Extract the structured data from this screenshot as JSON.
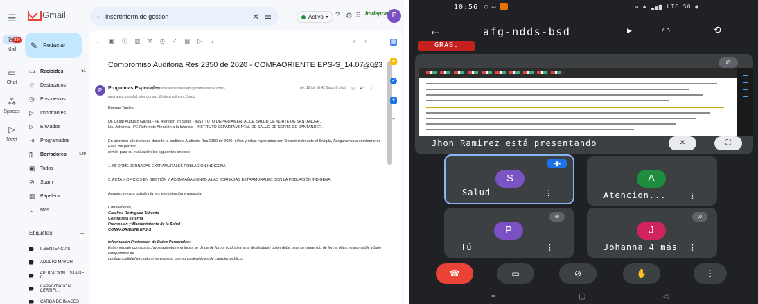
{
  "gmail": {
    "app_name": "Gmail",
    "search": {
      "query": "insertinform de gestion"
    },
    "status": "Activo",
    "org_logo": "Imdepran",
    "avatar_letter": "P",
    "rail": [
      {
        "label": "Mail",
        "badge": "•"
      },
      {
        "label": "Chat"
      },
      {
        "label": "Spaces"
      },
      {
        "label": "Meet"
      }
    ],
    "compose": "Redactar",
    "nav": [
      {
        "label": "Recibidos",
        "count": "51",
        "icon": "inbox-icon"
      },
      {
        "label": "Destacados",
        "icon": "star-icon"
      },
      {
        "label": "Pospuestos",
        "icon": "clock-icon"
      },
      {
        "label": "Importantes",
        "icon": "important-icon"
      },
      {
        "label": "Enviados",
        "icon": "send-icon"
      },
      {
        "label": "Programados",
        "icon": "scheduled-icon"
      },
      {
        "label": "Borradores",
        "count": "149",
        "icon": "draft-icon"
      },
      {
        "label": "Todos",
        "icon": "all-mail-icon"
      },
      {
        "label": "Spam",
        "icon": "spam-icon"
      },
      {
        "label": "Papelera",
        "icon": "trash-icon"
      },
      {
        "label": "Más",
        "icon": "chevron-down-icon"
      }
    ],
    "labels_title": "Etiquetas",
    "labels": [
      "9.SENTENCIAS",
      "ADULTO MAYOR",
      "APLICACION LISTA DE C...",
      "CAPACITACION CERTIFI...",
      "CARGA DE IMAGES"
    ],
    "mail": {
      "subject": "Compromiso Auditoria Res 2350 de 2020 - COMFAORIENTE EPS-S_14.07.2023",
      "sender_name": "Programas Especiales",
      "sender_email": "<programasespeciales.eps@comfaoriente.com>",
      "sender_to": "para atencionsalud, atencionsa...@iolsg.mail.com, Salud",
      "date": "mié, 19 jul, 18:42 (hace 9 días)",
      "body": [
        "Buenas Tardes",
        "Dr. Cesar Augusto Garcia - PE Atención en Salud - INSTITUTO DEPARTAMENTAL DE SALUD DE NORTE DE SANTANDER.\nLic. Johanna -  PE Referente Atención a la Infancia - INSTITUTO DEPARTAMENTAL DE SALUD DE NORTE DE SANTANDER.",
        "En atención a lo indicado durante la auditoria Auditoria Res 2350 de 2020, niños y niñas reportadas con Desnutrición ante el Sivigila, Aseguramos a comfaoriente Eoss me permito\nremitir para su evaluación los siguientes anexos:",
        "1.INFORME JORNADAS EXTRAMURALES POBLACION INDIGENA",
        "2. ACTA Y OFICIOS EN GESTIÓN Y ACOMPAÑAMIENTO A LAS JORNADAS EXTRAMURALES CON LA POBLACIÓN INDIGENA.",
        "Agradecemos a ustedes la vez eso atención y asesoria."
      ],
      "signature": [
        "Cordialmente,",
        "Carolina Rodriguez Taborda",
        "Contratista externa",
        "Promoción y Mantenimiento de la Salud",
        "COMFAORIENTE EPS-S"
      ],
      "footer_title": "Información Protección de Datos Personales:",
      "footer_text": "Este mensaje con sus archivos adjuntos y enlaces  se dirige de forma exclusiva a su destinatario quien debe usar su contenido de forma ética, responsable y bajo compromiso de\nconfidencialidad  excepto si es expreso que su contenido es de carácter publico."
    }
  },
  "meet": {
    "time": "10:56",
    "status_right": "LTE 50",
    "meeting_code": "afg-ndds-bsd",
    "recording_label": "GRAB.",
    "presenting_text": "Jhon Ramirez está presentando",
    "tiles": [
      {
        "letter": "S",
        "name": "Salud",
        "color": "#7b54c4",
        "speaking": true
      },
      {
        "letter": "A",
        "name": "Atencion...",
        "color": "#1e8e3e",
        "muted": false
      },
      {
        "letter": "P",
        "name": "Tú",
        "color": "#7b50c2",
        "muted": true
      },
      {
        "letter": "J",
        "name": "Johanna 4 más",
        "color": "#d1245f",
        "muted": true
      }
    ],
    "controls": [
      "end-call",
      "camera-off",
      "mic-off",
      "raise-hand",
      "more"
    ]
  }
}
